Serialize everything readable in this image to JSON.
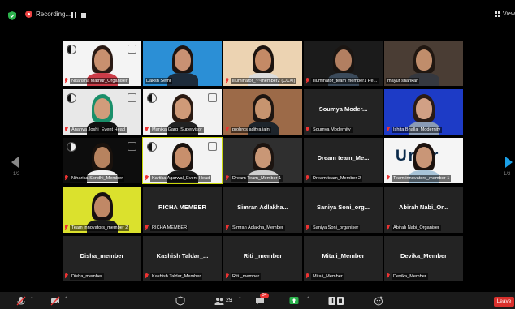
{
  "topbar": {
    "recording_label": "Recording...",
    "view_label": "View"
  },
  "pagination": {
    "left": "1/2",
    "right": "1/2"
  },
  "participants": [
    {
      "name": "Nitansha Mathur_Organiser",
      "kind": "video",
      "active": false,
      "logo": true
    },
    {
      "name": "Daksh Sethi",
      "kind": "video",
      "active": false,
      "muted": false
    },
    {
      "name": "illuminator_~~member2 (CCXI)",
      "kind": "video",
      "active": false
    },
    {
      "name": "illuminator_team member1 Pe...",
      "kind": "video",
      "active": false
    },
    {
      "name": "mayur shankar",
      "kind": "video",
      "active": false,
      "muted": false
    },
    {
      "name": "Ananya Joshi_Event Head",
      "kind": "video",
      "active": false,
      "logo": true
    },
    {
      "name": "Manika Garg_Supervisor",
      "kind": "video",
      "active": false,
      "logo": true
    },
    {
      "name": "probros aditya jain",
      "kind": "video",
      "active": false
    },
    {
      "name": "Soumya Modernity",
      "kind": "name",
      "display": "Soumya Moder...",
      "active": false
    },
    {
      "name": "Ishita Bhalla_Modernity",
      "kind": "video",
      "active": false
    },
    {
      "name": "Niharika Sondhi_Member",
      "kind": "video",
      "active": false,
      "logo": true
    },
    {
      "name": "Kartika Agarwal_Event Head",
      "kind": "video",
      "active": true,
      "logo": true
    },
    {
      "name": "Dream Team_Member 1",
      "kind": "video",
      "active": false
    },
    {
      "name": "Dream team_Member 2",
      "kind": "name",
      "display": "Dream team_Me...",
      "active": false
    },
    {
      "name": "Team innovators_member 1",
      "kind": "video",
      "active": false,
      "overlay": "Ur  er"
    },
    {
      "name": "Team innovators_member 2",
      "kind": "video",
      "active": false
    },
    {
      "name": "RICHA MEMBER",
      "kind": "name",
      "display": "RICHA MEMBER",
      "active": false
    },
    {
      "name": "Simran Adlakha_Member",
      "kind": "name",
      "display": "Simran Adlakha...",
      "active": false
    },
    {
      "name": "Saniya Soni_organiser",
      "kind": "name",
      "display": "Saniya Soni_org...",
      "active": false
    },
    {
      "name": "Abirah Nabi_Organiser",
      "kind": "name",
      "display": "Abirah Nabi_Or...",
      "active": false
    },
    {
      "name": "Disha_member",
      "kind": "name",
      "display": "Disha_member",
      "active": false
    },
    {
      "name": "Kashish Taldar_Member",
      "kind": "name",
      "display": "Kashish Taldar_...",
      "active": false
    },
    {
      "name": "Riti _member",
      "kind": "name",
      "display": "Riti _member",
      "active": false
    },
    {
      "name": "Mitali_Member",
      "kind": "name",
      "display": "Mitali_Member",
      "active": false
    },
    {
      "name": "Devika_Member",
      "kind": "name",
      "display": "Devika_Member",
      "active": false
    }
  ],
  "toolbar": {
    "participants_count": "29",
    "chat_badge": "34",
    "leave_label": "Leave"
  },
  "colors": {
    "active_speaker": "#c9d60a",
    "leave": "#d9302c",
    "nav_right": "#1ba0e8",
    "mute": "#ee3333"
  }
}
